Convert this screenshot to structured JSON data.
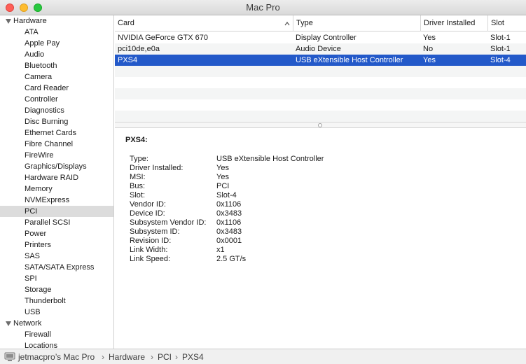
{
  "window": {
    "title": "Mac Pro"
  },
  "sidebar": {
    "hardware_label": "Hardware",
    "hardware_items": [
      "ATA",
      "Apple Pay",
      "Audio",
      "Bluetooth",
      "Camera",
      "Card Reader",
      "Controller",
      "Diagnostics",
      "Disc Burning",
      "Ethernet Cards",
      "Fibre Channel",
      "FireWire",
      "Graphics/Displays",
      "Hardware RAID",
      "Memory",
      "NVMExpress",
      "PCI",
      "Parallel SCSI",
      "Power",
      "Printers",
      "SAS",
      "SATA/SATA Express",
      "SPI",
      "Storage",
      "Thunderbolt",
      "USB"
    ],
    "network_label": "Network",
    "network_items": [
      "Firewall",
      "Locations"
    ],
    "selected": "PCI"
  },
  "table": {
    "columns": [
      "Card",
      "Type",
      "Driver Installed",
      "Slot"
    ],
    "rows": [
      [
        "NVIDIA GeForce GTX 670",
        "Display Controller",
        "Yes",
        "Slot-1"
      ],
      [
        "pci10de,e0a",
        "Audio Device",
        "No",
        "Slot-1"
      ],
      [
        "PXS4",
        "USB eXtensible Host Controller",
        "Yes",
        "Slot-4"
      ]
    ],
    "selected_row": 2
  },
  "detail": {
    "title": "PXS4:",
    "fields": [
      {
        "label": "Type:",
        "value": "USB eXtensible Host Controller"
      },
      {
        "label": "Driver Installed:",
        "value": "Yes"
      },
      {
        "label": "MSI:",
        "value": "Yes"
      },
      {
        "label": "Bus:",
        "value": "PCI"
      },
      {
        "label": "Slot:",
        "value": "Slot-4"
      },
      {
        "label": "Vendor ID:",
        "value": "0x1106"
      },
      {
        "label": "Device ID:",
        "value": "0x3483"
      },
      {
        "label": "Subsystem Vendor ID:",
        "value": "0x1106"
      },
      {
        "label": "Subsystem ID:",
        "value": "0x3483"
      },
      {
        "label": "Revision ID:",
        "value": "0x0001"
      },
      {
        "label": "Link Width:",
        "value": "x1"
      },
      {
        "label": "Link Speed:",
        "value": "2.5 GT/s"
      }
    ]
  },
  "pathbar": {
    "segments": [
      "jetmacpro’s Mac Pro",
      "Hardware",
      "PCI",
      "PXS4"
    ]
  },
  "colors": {
    "selection": "#2359c9",
    "sidebar_selected": "#dcdcdc"
  },
  "icons": {
    "sort": "chevron-up-icon",
    "computer": "computer-icon",
    "disclosure": "disclosure-triangle-icon"
  }
}
